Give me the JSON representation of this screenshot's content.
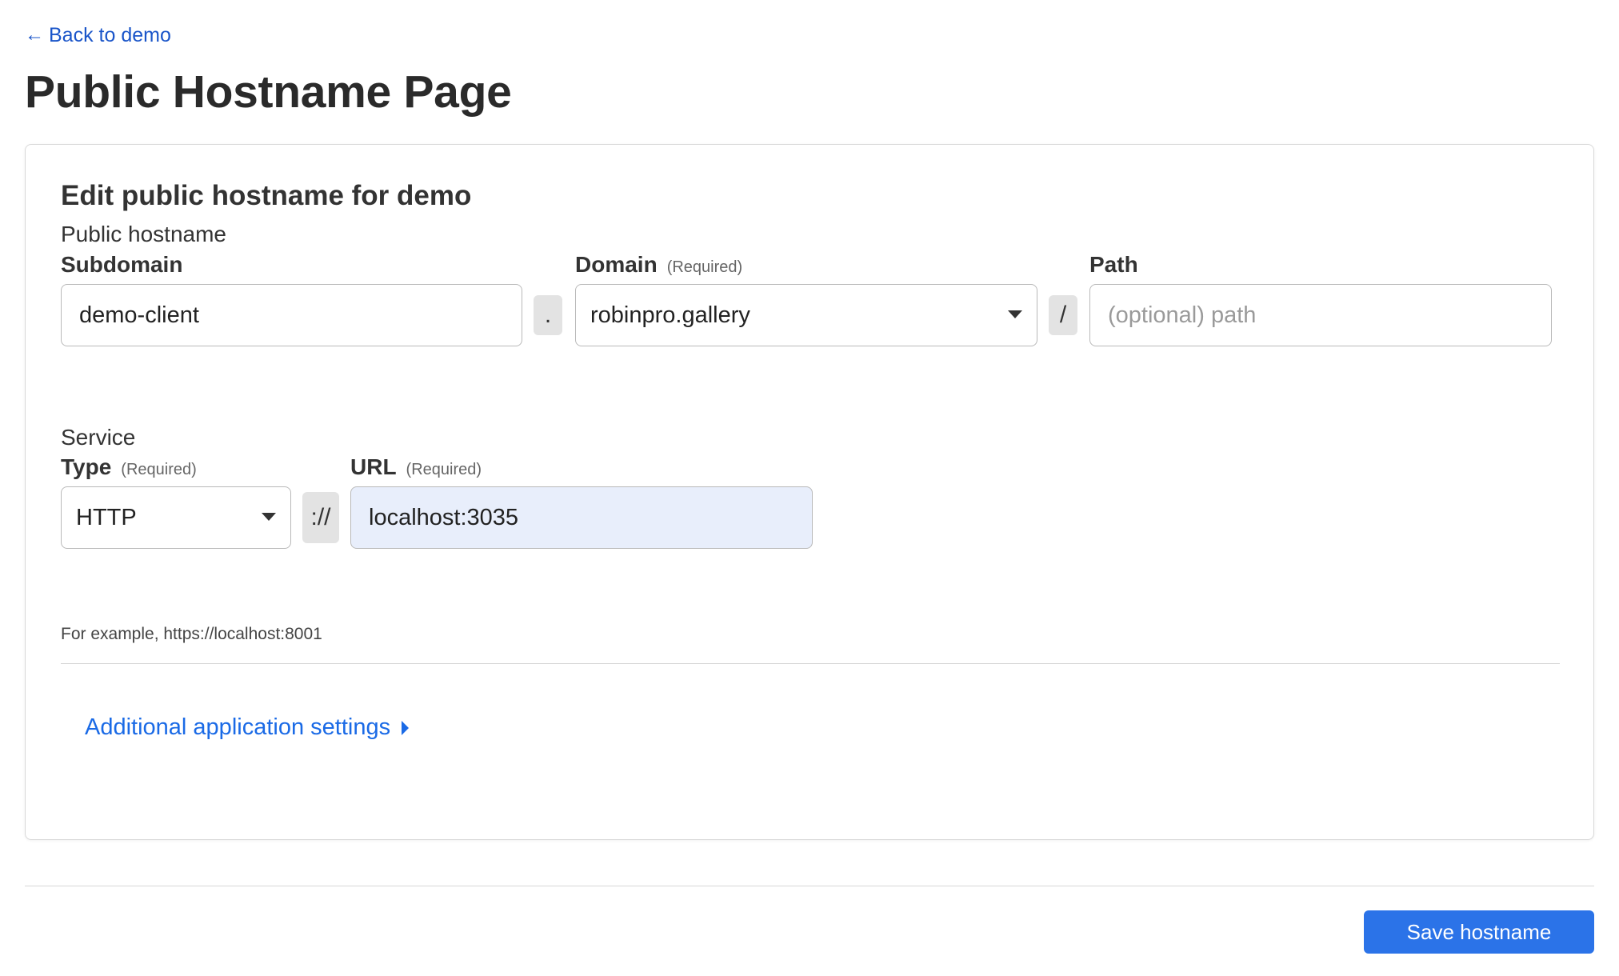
{
  "nav": {
    "back_label": "Back to demo",
    "back_icon": "arrow-left-icon"
  },
  "page": {
    "title": "Public Hostname Page"
  },
  "form": {
    "card_title": "Edit public hostname for demo",
    "public_hostname": {
      "section_label": "Public hostname",
      "subdomain": {
        "label": "Subdomain",
        "value": "demo-client"
      },
      "dot_separator": ".",
      "domain": {
        "label": "Domain",
        "required_text": "(Required)",
        "selected": "robinpro.gallery",
        "icon": "caret-down-icon"
      },
      "slash_separator": "/",
      "path": {
        "label": "Path",
        "value": "",
        "placeholder": "(optional) path"
      }
    },
    "service": {
      "section_label": "Service",
      "type": {
        "label": "Type",
        "required_text": "(Required)",
        "selected": "HTTP",
        "icon": "caret-down-icon"
      },
      "scheme_separator": "://",
      "url": {
        "label": "URL",
        "required_text": "(Required)",
        "value": "localhost:3035"
      },
      "hint": "For example, https://localhost:8001"
    },
    "additional_settings": {
      "label": "Additional application settings",
      "icon": "caret-right-icon"
    }
  },
  "footer": {
    "save_label": "Save hostname"
  },
  "colors": {
    "link": "#1a55c9",
    "accent_link": "#1a6ae6",
    "primary_button": "#2b73e8",
    "url_field_bg": "#e8eefb"
  }
}
